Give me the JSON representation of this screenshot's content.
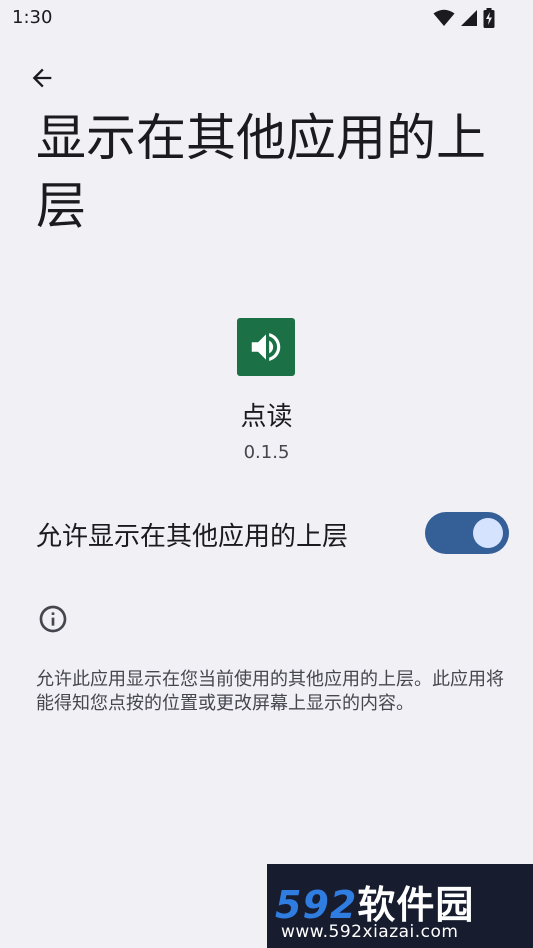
{
  "status_bar": {
    "time": "1:30",
    "icons": [
      "wifi-icon",
      "cellular-signal-icon",
      "battery-charging-icon"
    ]
  },
  "header": {
    "back_icon": "arrow-left-icon",
    "title": "显示在其他应用的上层"
  },
  "app": {
    "icon": "speaker-icon",
    "icon_color": "#1b7046",
    "name": "点读",
    "version": "0.1.5"
  },
  "permission": {
    "label": "允许显示在其他应用的上层",
    "enabled": true,
    "toggle_color": "#355f97"
  },
  "info": {
    "icon": "info-icon",
    "text": "允许此应用显示在您当前使用的其他应用的上层。此应用将能得知您点按的位置或更改屏幕上显示的内容。"
  },
  "watermark": {
    "logo_number": "592",
    "logo_text": "软件园",
    "url": "www.592xiazai.com"
  }
}
